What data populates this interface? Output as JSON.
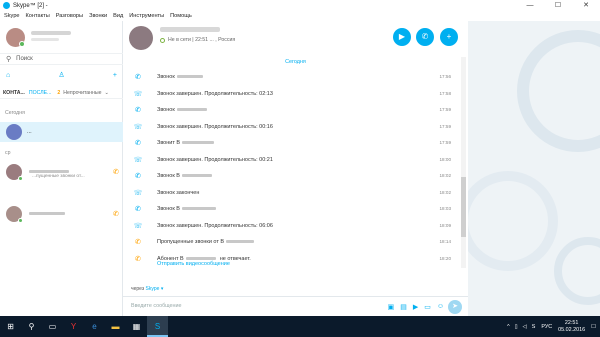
{
  "window": {
    "title": "Skype™ [2] - ",
    "minimize": "—",
    "maximize": "☐",
    "close": "✕"
  },
  "menu": [
    "Skype",
    "Контакты",
    "Разговоры",
    "Звонки",
    "Вид",
    "Инструменты",
    "Помощь"
  ],
  "sidebar": {
    "search_label": "Поиск",
    "tabs": {
      "contacts": "КОНТА...",
      "recent": "ПОСЛЕ...",
      "unread_count": "2",
      "unread": "Непрочитанные"
    },
    "section_today": "Сегодня",
    "section_wed": "ср",
    "contacts": [
      {
        "name": "...",
        "sub": ""
      },
      {
        "name": "",
        "sub": "...пущенные звонки от..."
      },
      {
        "name": "",
        "sub": ""
      }
    ]
  },
  "chat": {
    "status": "Не в сети | 22:51 ...  , Россия",
    "day_label": "Сегодня",
    "messages": [
      {
        "icon": "call-icon",
        "text": "Звонок ",
        "time": "17:56"
      },
      {
        "icon": "call-end-icon",
        "text": "Звонок завершен. Продолжительность: 02:13",
        "time": "17:58"
      },
      {
        "icon": "call-icon",
        "text": "Звонок ",
        "time": "17:59"
      },
      {
        "icon": "call-end-icon",
        "text": "Звонок завершен. Продолжительность: 00:16",
        "time": "17:59"
      },
      {
        "icon": "call-icon",
        "text": "Звонит В",
        "time": "17:59"
      },
      {
        "icon": "call-end-icon",
        "text": "Звонок завершен. Продолжительность: 00:21",
        "time": "18:00"
      },
      {
        "icon": "call-icon",
        "text": "Звонок В",
        "time": "18:02"
      },
      {
        "icon": "call-end-icon",
        "text": "Звонок закончен",
        "time": "18:02"
      },
      {
        "icon": "call-icon",
        "text": "Звонок В",
        "time": "18:03"
      },
      {
        "icon": "call-end-icon",
        "text": "Звонок завершен. Продолжительность: 06:06",
        "time": "18:09"
      },
      {
        "icon": "missed-call-icon",
        "text": "Пропущенные звонки от В",
        "time": "18:14"
      },
      {
        "icon": "missed-call-icon",
        "text": "Абонент В",
        "time": "18:20"
      }
    ],
    "no_answer_suffix": "не отвечает.",
    "video_link": "Отправить видеосообщение"
  },
  "compose": {
    "via": "через",
    "via_service": "Skype ▾",
    "placeholder": "Введите сообщение"
  },
  "taskbar": {
    "lang": "РУС",
    "time": "22:51",
    "date": "05.02.2016"
  },
  "colors": {
    "accent": "#00aff0",
    "online": "#5cb85c",
    "missed": "#ffa200",
    "taskbar": "#0b1a2b"
  }
}
